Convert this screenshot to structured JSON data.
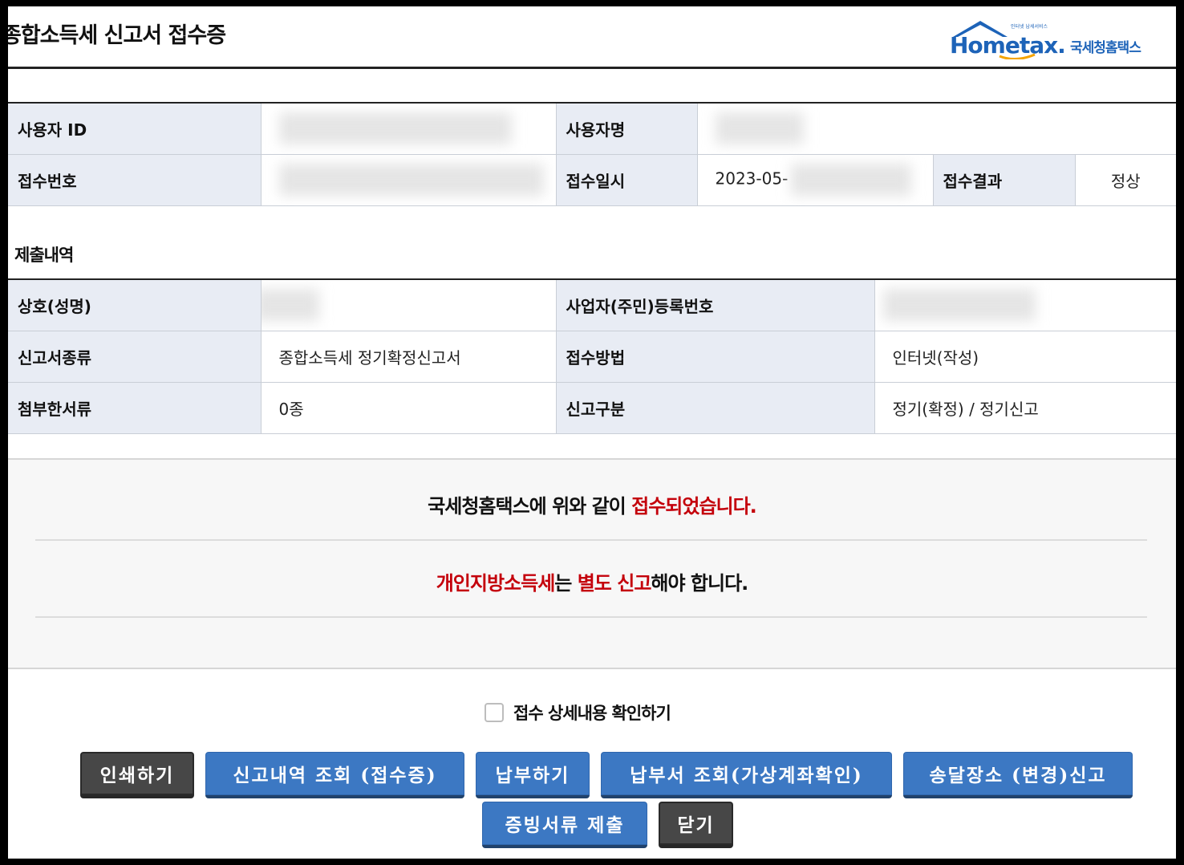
{
  "header": {
    "title": "종합소득세 신고서 접수증",
    "logo_text": "Hometax.",
    "logo_korean": "국세청홈택스",
    "logo_tagline": "인터넷 납세서비스",
    "brand_color": "#1d63b8"
  },
  "user_info": {
    "user_id_label": "사용자 ID",
    "user_id_value": "",
    "user_name_label": "사용자명",
    "user_name_value": "",
    "receipt_no_label": "접수번호",
    "receipt_no_value": "",
    "receipt_date_label": "접수일시",
    "receipt_date_value": "2023-05-",
    "receipt_result_label": "접수결과",
    "receipt_result_value": "정상"
  },
  "submission": {
    "section_title": "제출내역",
    "company_label": "상호(성명)",
    "company_value": "",
    "reg_no_label": "사업자(주민)등록번호",
    "reg_no_value": "",
    "form_type_label": "신고서종류",
    "form_type_value": "종합소득세 정기확정신고서",
    "method_label": "접수방법",
    "method_value": "인터넷(작성)",
    "attachments_label": "첨부한서류",
    "attachments_value": "0종",
    "category_label": "신고구분",
    "category_value": "정기(확정) / 정기신고"
  },
  "notice": {
    "line1_prefix": "국세청홈택스에 위와 같이 ",
    "line1_highlight": "접수되었습니다.",
    "line2_highlight1": "개인지방소득세",
    "line2_mid": "는 ",
    "line2_highlight2": "별도 신고",
    "line2_suffix": "해야 합니다.",
    "highlight_color": "#c4000b"
  },
  "detail_checkbox": {
    "label": "접수 상세내용 확인하기",
    "checked": false
  },
  "buttons": {
    "print": "인쇄하기",
    "history": "신고내역 조회 (접수증)",
    "pay": "납부하기",
    "payment_slip": "납부서 조회(가상계좌확인)",
    "delivery_address": "송달장소 (변경)신고",
    "evidence": "증빙서류 제출",
    "close": "닫기",
    "blue_color": "#3c78c3",
    "dark_color": "#474747"
  }
}
